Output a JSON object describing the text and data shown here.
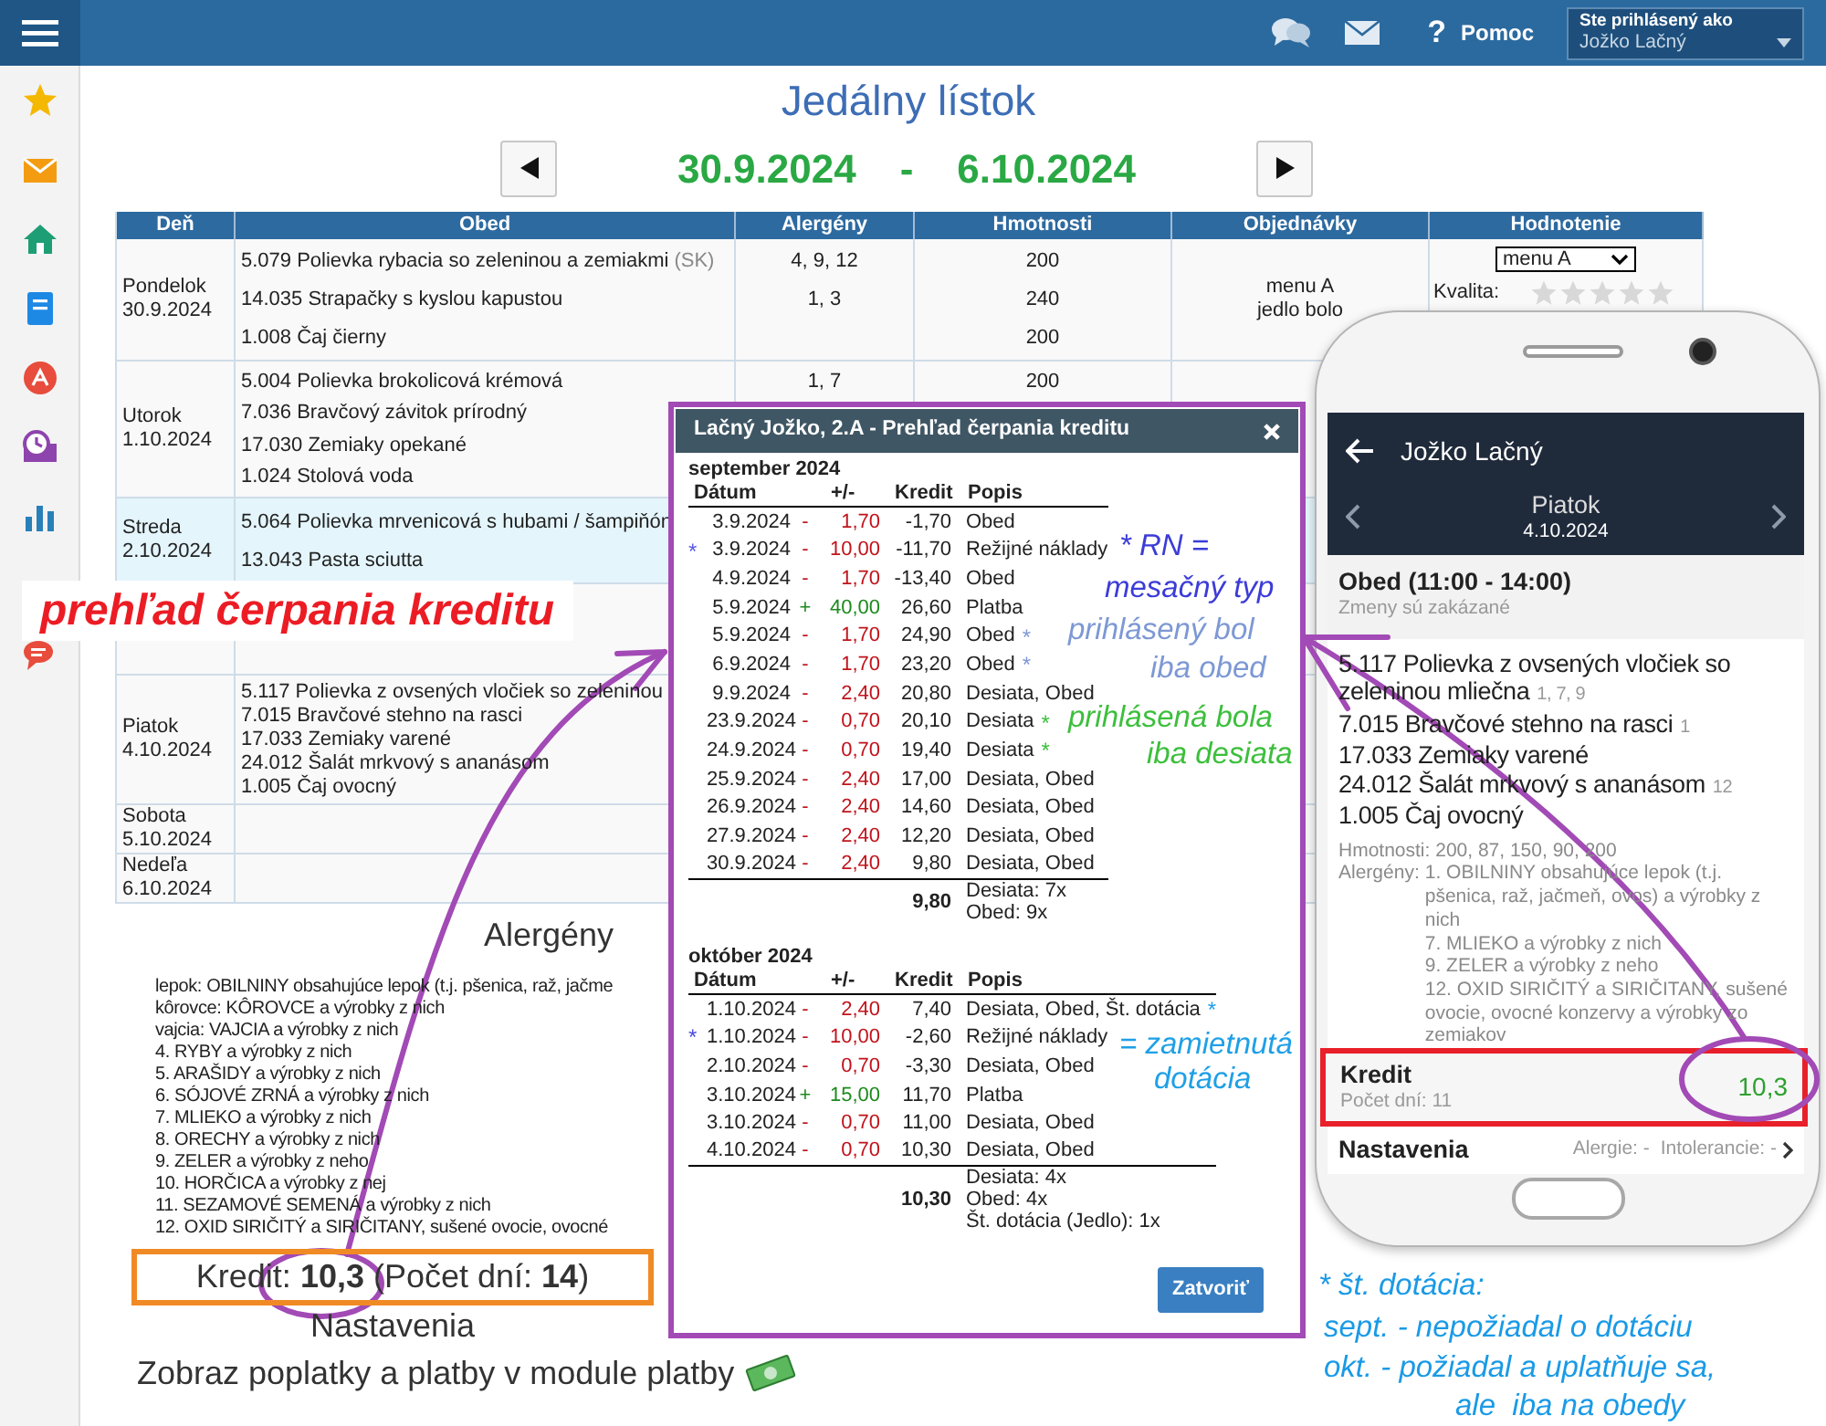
{
  "topbar": {
    "help_icon": "?",
    "help": "Pomoc",
    "user_label": "Ste prihlásený ako",
    "user_name": "Jožko Lačný"
  },
  "page": {
    "title": "Jedálny lístok",
    "date_from": "30.9.2024",
    "date_sep": "-",
    "date_to": "6.10.2024"
  },
  "table": {
    "columns": [
      "Deň",
      "Obed",
      "Alergény",
      "Hmotnosti",
      "Objednávky",
      "Hodnotenie"
    ],
    "rows": [
      {
        "day": "Pondelok",
        "date": "30.9.2024",
        "selected": false,
        "meals": [
          {
            "name": "5.079 Polievka rybacia so zeleninou a zemiakmi",
            "tag": "(SK)",
            "allergens": "4, 9, 12",
            "weight": "200"
          },
          {
            "name": "14.035 Strapačky s kyslou kapustou",
            "allergens": "1, 3",
            "weight": "240"
          },
          {
            "name": "1.008 Čaj čierny",
            "weight": "200"
          }
        ],
        "orders": [
          "menu A",
          "jedlo bolo"
        ],
        "rating": {
          "select": "menu A",
          "label": "Kvalita:",
          "stars": 0
        }
      },
      {
        "day": "Utorok",
        "date": "1.10.2024",
        "selected": false,
        "meals": [
          {
            "name": "5.004 Polievka brokolicová krémová",
            "allergens": "1, 7",
            "weight": "200"
          },
          {
            "name": "7.036 Bravčový závitok prírodný"
          },
          {
            "name": "17.030 Zemiaky opekané"
          },
          {
            "name": "1.024 Stolová voda"
          }
        ]
      },
      {
        "day": "Streda",
        "date": "2.10.2024",
        "selected": true,
        "meals": [
          {
            "name": "5.064 Polievka mrvenicová s hubami / šampiňón"
          },
          {
            "name": "13.043 Pasta sciutta"
          }
        ]
      },
      {
        "day": "Piatok",
        "date": "4.10.2024",
        "selected": false,
        "meals": [
          {
            "name": "5.117 Polievka z ovsených vločiek so zeleninou"
          },
          {
            "name": "7.015 Bravčové stehno na rasci"
          },
          {
            "name": "17.033 Zemiaky varené"
          },
          {
            "name": "24.012 Šalát mrkvový s ananásom"
          },
          {
            "name": "1.005 Čaj ovocný"
          }
        ]
      },
      {
        "day": "Sobota",
        "date": "5.10.2024",
        "selected": false
      },
      {
        "day": "Nedeľa",
        "date": "6.10.2024",
        "selected": false
      }
    ]
  },
  "callout": "prehľad čerpania kreditu",
  "allergens": {
    "title": "Alergény",
    "items": [
      "lepok: OBILNINY obsahujúce lepok (t.j. pšenica, raž, jačme",
      "kôrovce: KÔROVCE a výrobky z nich",
      "vajcia: VAJCIA a výrobky z nich",
      "4. RYBY a výrobky z nich",
      "5. ARAŠIDY a výrobky z nich",
      "6. SÓJOVÉ ZRNÁ a výrobky z nich",
      "7. MLIEKO a výrobky z nich",
      "8. ORECHY a výrobky z nich",
      "9. ZELER a výrobky z neho",
      "10. HORČICA a výrobky z nej",
      "11. SEZAMOVÉ SEMENÁ a výrobky z nich",
      "12. OXID SIRIČITÝ a SIRIČITANY, sušené ovocie, ovocné"
    ]
  },
  "credit_summary": "Kredit: **10,3** (Počet dní: **14**)",
  "settings": "Nastavenia",
  "payments_link": "Zobraz poplatky a platby v module platby",
  "dialog": {
    "title": "Lačný Jožko, 2.A - Prehľad čerpania kreditu",
    "close": "Zatvoriť",
    "months": [
      {
        "title": "september 2024",
        "headers": [
          "Dátum",
          "+/-",
          "Kredit",
          "Popis"
        ],
        "rows": [
          {
            "date": "3.9.2024",
            "kind": "debit",
            "sign": "-",
            "amount": "1,70",
            "balance": "-1,70",
            "desc": "Obed"
          },
          {
            "date": "3.9.2024",
            "kind": "debit",
            "sign": "-",
            "amount": "10,00",
            "balance": "-11,70",
            "desc": "Režijné náklady",
            "mark_before": {
              "text": "*",
              "color": "#5a5ae6"
            }
          },
          {
            "date": "4.9.2024",
            "kind": "debit",
            "sign": "-",
            "amount": "1,70",
            "balance": "-13,40",
            "desc": "Obed"
          },
          {
            "date": "5.9.2024",
            "kind": "credit",
            "sign": "+",
            "amount": "40,00",
            "balance": "26,60",
            "desc": "Platba"
          },
          {
            "date": "5.9.2024",
            "kind": "debit",
            "sign": "-",
            "amount": "1,70",
            "balance": "24,90",
            "desc": "Obed",
            "mark_after": {
              "text": "*",
              "color": "#7d98d4"
            }
          },
          {
            "date": "6.9.2024",
            "kind": "debit",
            "sign": "-",
            "amount": "1,70",
            "balance": "23,20",
            "desc": "Obed",
            "mark_after": {
              "text": "*",
              "color": "#7d98d4"
            }
          },
          {
            "date": "9.9.2024",
            "kind": "debit",
            "sign": "-",
            "amount": "2,40",
            "balance": "20,80",
            "desc": "Desiata, Obed"
          },
          {
            "date": "23.9.2024",
            "kind": "debit",
            "sign": "-",
            "amount": "0,70",
            "balance": "20,10",
            "desc": "Desiata",
            "mark_after": {
              "text": "*",
              "color": "#3cbf3c"
            }
          },
          {
            "date": "24.9.2024",
            "kind": "debit",
            "sign": "-",
            "amount": "0,70",
            "balance": "19,40",
            "desc": "Desiata",
            "mark_after": {
              "text": "*",
              "color": "#3cbf3c"
            }
          },
          {
            "date": "25.9.2024",
            "kind": "debit",
            "sign": "-",
            "amount": "2,40",
            "balance": "17,00",
            "desc": "Desiata, Obed"
          },
          {
            "date": "26.9.2024",
            "kind": "debit",
            "sign": "-",
            "amount": "2,40",
            "balance": "14,60",
            "desc": "Desiata, Obed"
          },
          {
            "date": "27.9.2024",
            "kind": "debit",
            "sign": "-",
            "amount": "2,40",
            "balance": "12,20",
            "desc": "Desiata, Obed"
          },
          {
            "date": "30.9.2024",
            "kind": "debit",
            "sign": "-",
            "amount": "2,40",
            "balance": "9,80",
            "desc": "Desiata, Obed"
          }
        ],
        "total": "9,80",
        "summary": [
          "Desiata: 7x",
          "Obed: 9x"
        ]
      },
      {
        "title": "október 2024",
        "headers": [
          "Dátum",
          "+/-",
          "Kredit",
          "Popis"
        ],
        "rows": [
          {
            "date": "1.10.2024",
            "kind": "debit",
            "sign": "-",
            "amount": "2,40",
            "balance": "7,40",
            "desc": "Desiata, Obed, Št. dotácia",
            "mark_after": {
              "text": "*",
              "color": "#1fa0e6"
            }
          },
          {
            "date": "1.10.2024",
            "kind": "debit",
            "sign": "-",
            "amount": "10,00",
            "balance": "-2,60",
            "desc": "Režijné náklady",
            "mark_before": {
              "text": "*",
              "color": "#4a4ae0"
            }
          },
          {
            "date": "2.10.2024",
            "kind": "debit",
            "sign": "-",
            "amount": "0,70",
            "balance": "-3,30",
            "desc": "Desiata, Obed"
          },
          {
            "date": "3.10.2024",
            "kind": "credit",
            "sign": "+",
            "amount": "15,00",
            "balance": "11,70",
            "desc": "Platba"
          },
          {
            "date": "3.10.2024",
            "kind": "debit",
            "sign": "-",
            "amount": "0,70",
            "balance": "11,00",
            "desc": "Desiata, Obed"
          },
          {
            "date": "4.10.2024",
            "kind": "debit",
            "sign": "-",
            "amount": "0,70",
            "balance": "10,30",
            "desc": "Desiata, Obed"
          }
        ],
        "total": "10,30",
        "summary": [
          "Desiata: 4x",
          "Obed: 4x",
          "Št. dotácia (Jedlo): 1x"
        ]
      }
    ]
  },
  "annotations": [
    {
      "text": "* RN =",
      "color": "#3c3cd8"
    },
    {
      "text": "mesačný typ",
      "color": "#3c3cd8"
    },
    {
      "text": "prihlásený bol",
      "color": "#7d98d4"
    },
    {
      "text": "iba obed",
      "color": "#7d98d4"
    },
    {
      "text": "prihlásená bola",
      "color": "#3cbf3c"
    },
    {
      "text": "iba desiata",
      "color": "#3cbf3c"
    },
    {
      "text": "= zamietnutá",
      "color": "#1fa0e6"
    },
    {
      "text": "dotácia",
      "color": "#1fa0e6"
    },
    {
      "text": "* št. dotácia:",
      "color": "#1a9ae6"
    },
    {
      "text": "sept. - nepožiadal o dotáciu",
      "color": "#1a9ae6"
    },
    {
      "text": "okt. - požiadal a uplatňuje sa,",
      "color": "#1a9ae6"
    },
    {
      "text": "ale  iba na obedy",
      "color": "#1a9ae6"
    }
  ],
  "phone": {
    "user": "Jožko Lačný",
    "day": "Piatok",
    "date": "4.10.2024",
    "meal_title": "Obed (11:00 - 14:00)",
    "meal_note": "Zmeny sú zakázané",
    "items": [
      {
        "name": "5.117 Polievka z ovsených vločiek so zeleninou mliečna",
        "allergens": "1, 7, 9"
      },
      {
        "name": "7.015 Bravčové stehno na rasci",
        "allergens": "1"
      },
      {
        "name": "17.033 Zemiaky varené"
      },
      {
        "name": "24.012 Šalát mrkvový s ananásom",
        "allergens": "12"
      },
      {
        "name": "1.005 Čaj ovocný"
      }
    ],
    "weights": "Hmotnosti: 200, 87, 150, 90, 200",
    "allergen_label": "Alergény:",
    "allergen_list": [
      "1. OBILNINY obsahujúce lepok (t.j. pšenica, raž, jačmeň, ovos) a výrobky z nich",
      "7. MLIEKO a výrobky z nich",
      "9. ZELER a výrobky z neho",
      "12. OXID SIRIČITÝ a SIRIČITANY, sušené ovocie, ovocné konzervy a výrobky zo zemiakov"
    ],
    "credit_label": "Kredit",
    "days": "Počet dní: 11",
    "credit": "10,3",
    "settings": "Nastavenia",
    "allergies": "Alergie: -",
    "intolerances": "Intolerancie: -"
  }
}
